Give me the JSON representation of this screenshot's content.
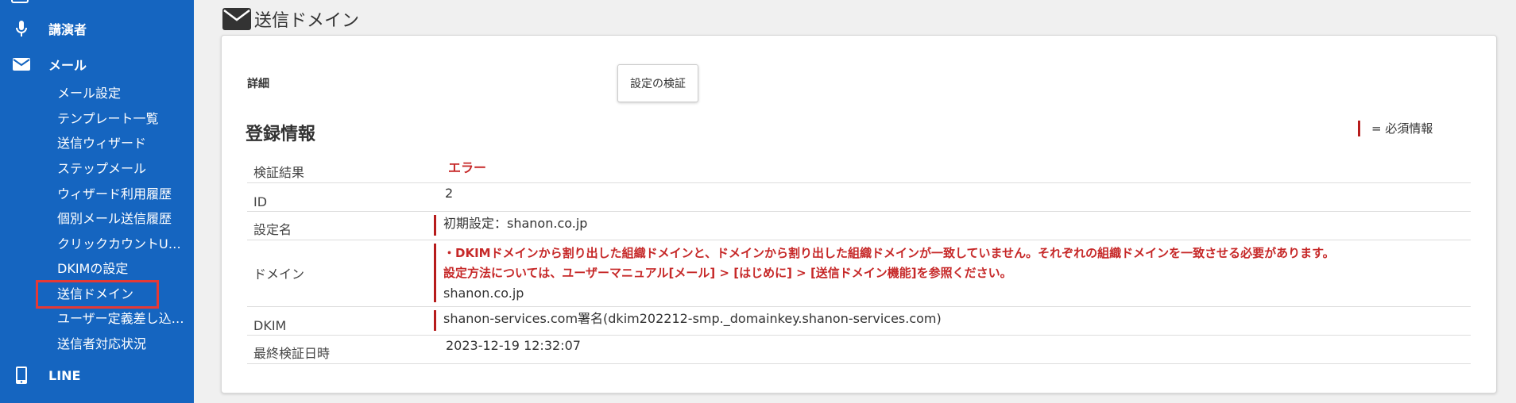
{
  "sidebar": {
    "sections": [
      {
        "label": "講演者",
        "icon": "microphone-icon"
      },
      {
        "label": "メール",
        "icon": "mail-icon"
      },
      {
        "label": "LINE",
        "icon": "smartphone-icon"
      }
    ],
    "mail_items": [
      "メール設定",
      "テンプレート一覧",
      "送信ウィザード",
      "ステップメール",
      "ウィザード利用履歴",
      "個別メール送信履歴",
      "クリックカウントU…",
      "DKIMの設定",
      "送信ドメイン",
      "ユーザー定義差し込…",
      "送信者対応状況"
    ],
    "active_item": "送信ドメイン",
    "highlight_color": "#e53935",
    "bg_color": "#1565c0"
  },
  "page": {
    "title": "送信ドメイン",
    "title_icon": "mail-icon"
  },
  "panel": {
    "detail_label": "詳細",
    "verify_button": "設定の検証",
    "registration_title": "登録情報",
    "required_note": "= 必須情報",
    "required_color": "#b71c1c"
  },
  "table": {
    "verify_result": {
      "key": "検証結果",
      "value": "エラー"
    },
    "id": {
      "key": "ID",
      "value": "2"
    },
    "setting_name": {
      "key": "設定名",
      "value": "初期設定：shanon.co.jp"
    },
    "domain": {
      "key": "ドメイン",
      "error_line1": "・DKIMドメインから割り出した組織ドメインと、ドメインから割り出した組織ドメインが一致していません。それぞれの組織ドメインを一致させる必要があります。",
      "error_line2": "設定方法については、ユーザーマニュアル[メール] > [はじめに] > [送信ドメイン機能]を参照ください。",
      "value": "shanon.co.jp"
    },
    "dkim": {
      "key": "DKIM",
      "value": "shanon-services.com署名(dkim202212-smp._domainkey.shanon-services.com)"
    },
    "last_verified": {
      "key": "最終検証日時",
      "value": "2023-12-19 12:32:07"
    }
  }
}
